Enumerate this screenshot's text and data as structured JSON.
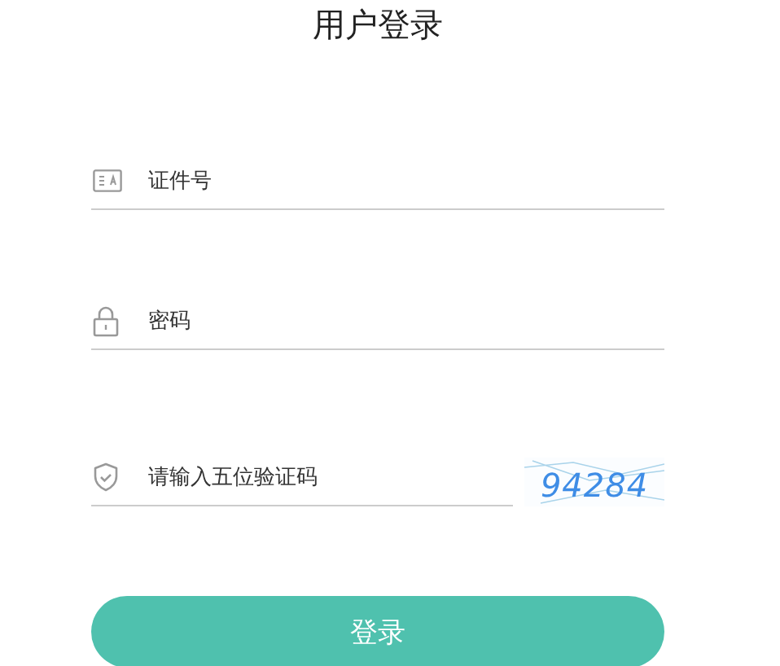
{
  "title": "用户登录",
  "fields": [
    {
      "kind": "id",
      "placeholder": "证件号"
    },
    {
      "kind": "password",
      "placeholder": "密码"
    },
    {
      "kind": "captcha",
      "placeholder": "请输入五位验证码",
      "captcha": "94284"
    }
  ],
  "submit": "登录"
}
